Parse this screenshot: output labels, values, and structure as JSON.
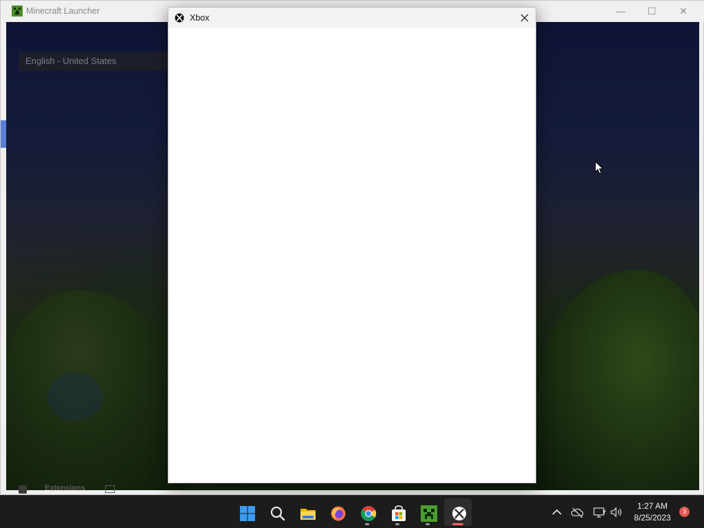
{
  "launcher": {
    "title": "Minecraft Launcher",
    "language": "English - United States",
    "bottom_nav_label": "Extensions",
    "controls": {
      "minimize": "—",
      "maximize": "☐",
      "close": "✕"
    }
  },
  "xbox_dialog": {
    "title": "Xbox"
  },
  "taskbar": {
    "apps": [
      {
        "name": "start",
        "icon": "windows-logo-icon"
      },
      {
        "name": "search",
        "icon": "search-icon"
      },
      {
        "name": "file-explorer",
        "icon": "folder-icon"
      },
      {
        "name": "firefox",
        "icon": "firefox-icon"
      },
      {
        "name": "chrome",
        "icon": "chrome-icon"
      },
      {
        "name": "microsoft-store",
        "icon": "store-icon"
      },
      {
        "name": "minecraft-launcher",
        "icon": "minecraft-icon"
      },
      {
        "name": "xbox",
        "icon": "xbox-icon"
      }
    ],
    "clock": {
      "time": "1:27 AM",
      "date": "8/25/2023"
    },
    "notification_count": "3"
  },
  "colors": {
    "taskbar_bg": "#1c1c1c",
    "active_indicator": "#ff5f5f",
    "notification_badge": "#e05a4f",
    "accent_blue": "#5b7fd6"
  }
}
